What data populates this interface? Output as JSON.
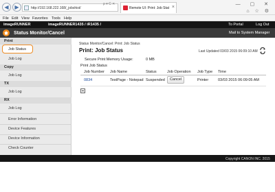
{
  "browser": {
    "back_glyph": "◀",
    "forward_glyph": "▶",
    "url": "http://192.168.222.168/_jobshist/",
    "address_icons": "ρ ▾ C ✕",
    "tab_title": "Remote UI: Print: Job Status...",
    "tab_close": "×",
    "window_controls": "— ▢ ✕",
    "tools_icons": "⌂ ☆ ⚙",
    "menu": [
      "File",
      "Edit",
      "View",
      "Favorites",
      "Tools",
      "Help"
    ]
  },
  "header": {
    "brand": "imageRUNNER",
    "device": "imageRUNNER1435 / iR1435 /",
    "to_portal": "To Portal",
    "logout": "Log Out",
    "title": "Status Monitor/Cancel",
    "mail_admin": "Mail to System Manager"
  },
  "sidebar": {
    "categories": [
      "Print",
      "Copy",
      "TX",
      "RX"
    ],
    "print_items": [
      "Job Status",
      "Job Log"
    ],
    "copy_items": [
      "Job Log"
    ],
    "tx_items": [
      "Job Log"
    ],
    "rx_items": [
      "Job Log",
      "Error Information",
      "Device Features",
      "Device Information",
      "Check Counter"
    ]
  },
  "main": {
    "breadcrumb": "Status Monitor/Cancel: Print: Job Status",
    "title": "Print: Job Status",
    "last_updated": "Last Updated 03/03 2015 06:09:10 AM",
    "memory_label": "Secure Print Memory Usage:",
    "memory_value": "0 MB",
    "section_title": "Print Job Status",
    "columns": [
      "Job Number",
      "Job Name",
      "Status",
      "Job Operation",
      "Job Type",
      "Time"
    ],
    "rows": [
      {
        "job_number": "0834",
        "job_name": "TestPage - Notepad",
        "status": "Suspended",
        "operation": "Cancel",
        "job_type": "Printer",
        "time": "03/03 2015 06:09:05 AM"
      }
    ]
  },
  "footer": {
    "copyright": "Copyright CANON INC. 2015"
  },
  "colors": {
    "accent": "#ec8a22",
    "header_dark": "#141414",
    "header_mid": "#3a3a3a",
    "link": "#1a4a9c"
  }
}
